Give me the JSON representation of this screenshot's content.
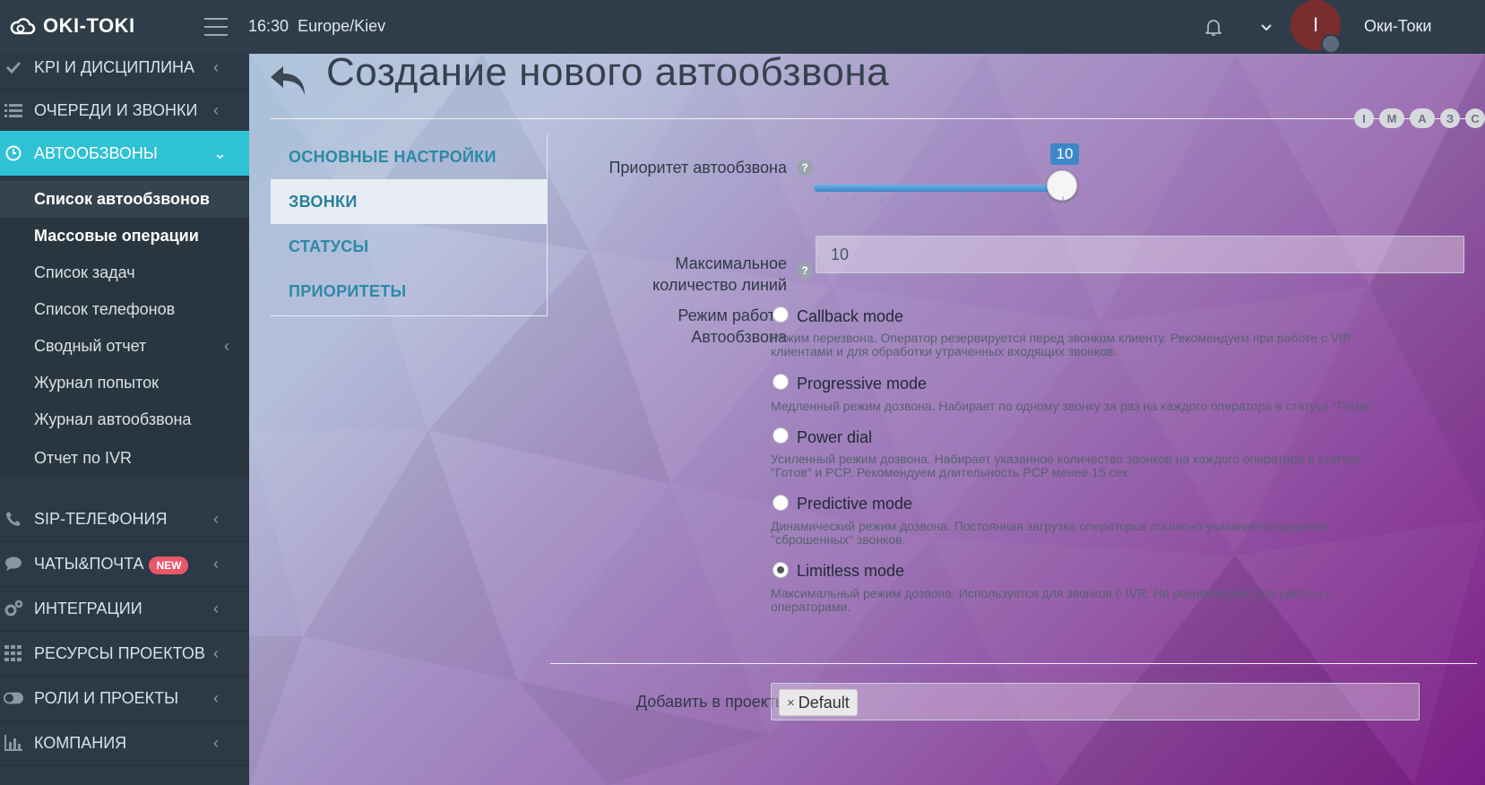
{
  "header": {
    "logo_text": "OKI-TOKI",
    "time": "16:30",
    "timezone": "Europe/Kiev",
    "avatar_letter": "I",
    "username": "Оки-Токи"
  },
  "sidebar": {
    "items": [
      {
        "label": "KPI И ДИСЦИПЛИНА",
        "icon": "check-icon"
      },
      {
        "label": "ОЧЕРЕДИ И ЗВОНКИ",
        "icon": "list-icon"
      },
      {
        "label": "АВТООБЗВОНЫ",
        "icon": "clock-icon"
      },
      {
        "label": "SIP-ТЕЛЕФОНИЯ",
        "icon": "phone-icon"
      },
      {
        "label": "ЧАТЫ&ПОЧТА",
        "icon": "chat-icon",
        "badge": "NEW"
      },
      {
        "label": "ИНТЕГРАЦИИ",
        "icon": "gears-icon"
      },
      {
        "label": "РЕСУРСЫ ПРОЕКТОВ",
        "icon": "grid-icon"
      },
      {
        "label": "РОЛИ И ПРОЕКТЫ",
        "icon": "toggle-icon"
      },
      {
        "label": "КОМПАНИЯ",
        "icon": "bar-chart-icon"
      }
    ],
    "sub_items": [
      "Список автообзвонов",
      "Массовые операции",
      "Список задач",
      "Список телефонов",
      "Сводный отчет",
      "Журнал попыток",
      "Журнал автообзвона",
      "Отчет по IVR"
    ]
  },
  "main": {
    "title": "Создание нового автообзвона",
    "steps": [
      "I",
      "M",
      "A",
      "З",
      "C"
    ],
    "tabs": [
      "ОСНОВНЫЕ НАСТРОЙКИ",
      "ЗВОНКИ",
      "СТАТУСЫ",
      "ПРИОРИТЕТЫ"
    ],
    "priority": {
      "label": "Приоритет автообзвона",
      "value": "10",
      "min": 1,
      "max": 10
    },
    "max_lines": {
      "label_line1": "Максимальное",
      "label_line2": "количество линий",
      "value": "10"
    },
    "mode": {
      "label_line1": "Режим работы",
      "label_line2": "Автообзвона",
      "options": [
        {
          "name": "Callback mode",
          "desc": "Режим перезвона. Оператор резервируется перед звонком клиенту. Рекомендуем при работе с VIP-клиентами и для обработки утраченных входящих звонков.",
          "selected": false
        },
        {
          "name": "Progressive mode",
          "desc": "Медленный режим дозвона. Набирает по одному звонку за раз на каждого оператора в статусе \"Готов\"",
          "selected": false
        },
        {
          "name": "Power dial",
          "desc": "Усиленный режим дозвона. Набирает указанное количество звонков на каждого оператора в статусе \"Готов\" и PCP. Рекомендуем длительность PCP менее 15 сек.",
          "selected": false
        },
        {
          "name": "Predictive mode",
          "desc": "Динамический режим дозвона. Постоянная загрузка операторов согласно указанного процента \"сброшенных\" звонков.",
          "selected": false
        },
        {
          "name": "Limitless mode",
          "desc": "Максимальный режим дозвона. Используется для звонков с IVR. Не рекомендуем для работы с операторами.",
          "selected": true
        }
      ]
    },
    "projects": {
      "label": "Добавить в проекты",
      "tag_remove": "×",
      "tag": "Default"
    }
  },
  "colors": {
    "accent": "#2fc1d4",
    "sidebar_bg": "#2c3a47",
    "badge": "#e8586a",
    "slider": "#3d86c8"
  }
}
